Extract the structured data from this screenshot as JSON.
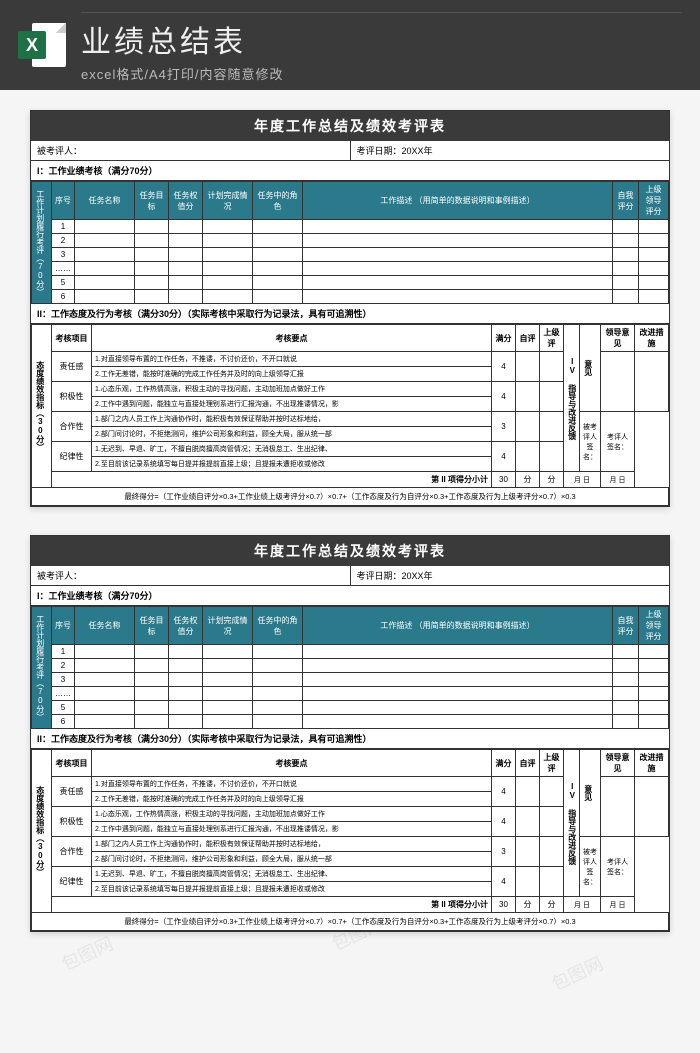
{
  "header": {
    "main_title": "业绩总结表",
    "sub_title": "excel格式/A4打印/内容随意修改",
    "icon_letter": "X"
  },
  "sheet": {
    "title": "年度工作总结及绩效考评表",
    "evaluatee_label": "被考评人：",
    "date_label": "考评日期：",
    "date_value": "20XX年",
    "section1_label": "I：工作业绩考核（满分70分）",
    "s1_cols": {
      "c0": "工作计划履行考评（70分）",
      "c1": "序号",
      "c2": "任务名称",
      "c3": "任务目标",
      "c4": "任务权值分",
      "c5": "计划完成情况",
      "c6": "任务中的角色",
      "c7": "工作描述\n（用简单的数据说明和事例描述）",
      "c8": "自我评分",
      "c9": "上级领导评分"
    },
    "s1_rows": [
      "1",
      "2",
      "3",
      "……",
      "5",
      "6"
    ],
    "section2_label": "II：工作态度及行为考核（满分30分）（实际考核中采取行为记录法，具有可追溯性）",
    "s2_side": "态度绩效指标（30分）",
    "s2_cols": {
      "c1": "考核项目",
      "c2": "考核要点",
      "c3": "满分",
      "c4": "自评",
      "c5": "上级评"
    },
    "s2_fb_side": "IV 指导与改进反馈",
    "s2_fb_cols": {
      "a": "意见",
      "b": "领导意见",
      "c": "改进措施"
    },
    "s2_items": [
      {
        "name": "责任感",
        "pts": [
          "1.对直接领导布置的工作任务，不推诿，不讨价还价，不开口就说",
          "2.工作无差错，能按时准确的完成工作任务并及时的向上级领导汇报"
        ],
        "score": "4"
      },
      {
        "name": "积极性",
        "pts": [
          "1.心态乐观，工作热情高涨，积极主动的寻找问题，主动加班加点做好工作",
          "2.工作中遇到问题，能独立与直接处理别系进行汇报沟通，不出现推诿情况，影"
        ],
        "score": "4"
      },
      {
        "name": "合作性",
        "pts": [
          "1.部门之内人员工作上沟通协作时，能积极有效保证帮助并按时达标地给，",
          "2.部门间讨论时，不拒绝测问，维护公司形象和利益，顾全大局，服从统一部"
        ],
        "score": "3"
      },
      {
        "name": "纪律性",
        "pts": [
          "1.无迟到、早退、旷工，不擅自脱岗擅高岗管情况；无消极怠工、生出纪律、",
          "2.至目前该记录系统填写每日提并报提前直接上级；且提报未遭拒收或修改"
        ],
        "score": "4"
      }
    ],
    "s2_sign": {
      "a": "被考评人签名：",
      "b": "考评人签名：",
      "c": "月  日",
      "d": "月  日"
    },
    "subtotal_label": "第 II 项得分小计",
    "subtotal_val1": "30",
    "subtotal_val2": "分",
    "subtotal_val3": "分",
    "formula": "最终得分=（工作业绩自评分×0.3+工作业绩上级考评分×0.7）×0.7+（工作态度及行为自评分×0.3+工作态度及行为上级考评分×0.7）×0.3"
  },
  "watermark": "包图网"
}
